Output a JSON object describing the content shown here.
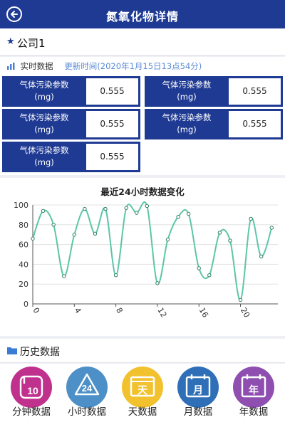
{
  "header": {
    "title": "氮氧化物详情",
    "back_icon": "back-arrow-circle-icon"
  },
  "company": {
    "name": "公司1",
    "icon": "star-icon"
  },
  "realtime": {
    "label": "实时数据",
    "updated": "更新时间(2020年1月15日13点54分)",
    "cards": [
      {
        "key_line1": "气体污染参数",
        "key_line2": "(mg)",
        "value": "0.555"
      },
      {
        "key_line1": "气体污染参数",
        "key_line2": "(mg)",
        "value": "0.555"
      },
      {
        "key_line1": "气体污染参数",
        "key_line2": "(mg)",
        "value": "0.555"
      },
      {
        "key_line1": "气体污染参数",
        "key_line2": "(mg)",
        "value": "0.555"
      },
      {
        "key_line1": "气体污染参数",
        "key_line2": "(mg)",
        "value": "0.555"
      }
    ]
  },
  "chart_data": {
    "type": "line",
    "title": "最近24小时数据变化",
    "x": [
      0,
      1,
      2,
      3,
      4,
      5,
      6,
      7,
      8,
      9,
      10,
      11,
      12,
      13,
      14,
      15,
      16,
      17,
      18,
      19,
      20,
      21,
      22,
      23
    ],
    "series": [
      {
        "values": [
          66,
          94,
          80,
          28,
          70,
          96,
          71,
          96,
          29,
          97,
          92,
          99,
          21,
          65,
          88,
          91,
          36,
          29,
          72,
          64,
          4,
          86,
          48,
          77
        ]
      }
    ],
    "xticks": [
      0,
      4,
      8,
      12,
      16,
      20
    ],
    "ylim": [
      0,
      100
    ],
    "yticks": [
      0,
      20,
      40,
      60,
      80,
      100
    ],
    "grid": true,
    "line_color": "#5cc6a8"
  },
  "history": {
    "label": "历史数据",
    "icon": "folder-icon"
  },
  "bottom_tabs": [
    {
      "label": "分钟数据",
      "icon": "minute-clock-icon",
      "glyph": "10",
      "color": "#c0318d"
    },
    {
      "label": "小时数据",
      "icon": "hour-recycle-icon",
      "glyph": "24",
      "color": "#4d8fc7"
    },
    {
      "label": "天数据",
      "icon": "day-calendar-icon",
      "glyph": "天",
      "color": "#f2c12e"
    },
    {
      "label": "月数据",
      "icon": "month-calendar-icon",
      "glyph": "月",
      "color": "#2f6fb7"
    },
    {
      "label": "年数据",
      "icon": "year-calendar-icon",
      "glyph": "年",
      "color": "#8e4fb0"
    }
  ]
}
